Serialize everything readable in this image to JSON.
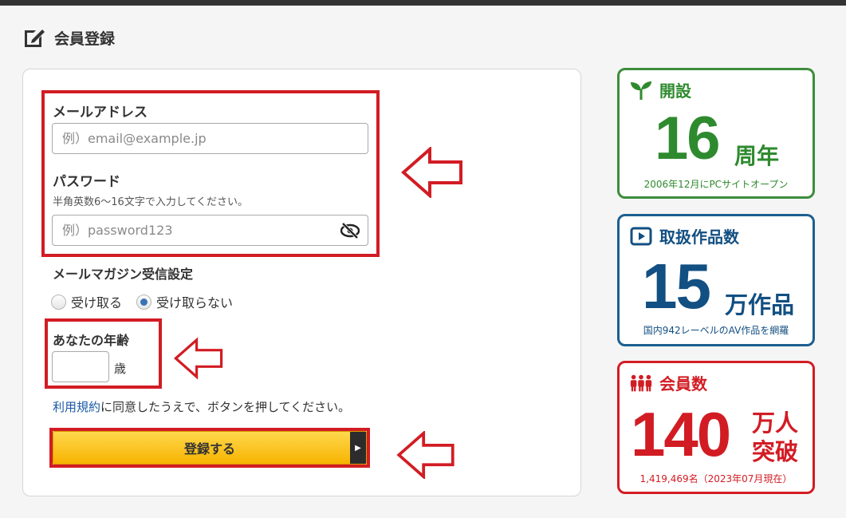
{
  "page": {
    "title": "会員登録",
    "title_icon": "edit-icon"
  },
  "form": {
    "email": {
      "label": "メールアドレス",
      "placeholder": "例）email@example.jp"
    },
    "password": {
      "label": "パスワード",
      "hint": "半角英数6〜16文字で入力してください。",
      "placeholder": "例）password123",
      "toggle_icon": "eye-slash-icon"
    },
    "newsletter": {
      "label": "メールマガジン受信設定",
      "options": [
        "受け取る",
        "受け取らない"
      ],
      "selected": "受け取らない"
    },
    "age": {
      "label": "あなたの年齢",
      "unit": "歳"
    },
    "terms": {
      "link": "利用規約",
      "text": "に同意したうえで、ボタンを押してください。"
    },
    "submit_label": "登録する"
  },
  "stats": [
    {
      "icon": "sprout-icon",
      "title": "開設",
      "number": "16",
      "suffix": "周年",
      "footnote": "2006年12月にPCサイトオープン",
      "color": "#2e8a2e"
    },
    {
      "icon": "play-icon",
      "title": "取扱作品数",
      "number": "15",
      "suffix": "万作品",
      "footnote": "国内942レーベルのAV作品を網羅",
      "color": "#124f82"
    },
    {
      "icon": "people-icon",
      "title": "会員数",
      "number": "140",
      "suffix_line1": "万人",
      "suffix_line2": "突破",
      "footnote": "1,419,469名（2023年07月現在）",
      "color": "#d21c24"
    }
  ],
  "colors": {
    "highlight": "#d21c24",
    "button": "#f7b300",
    "link": "#1a5aa6"
  }
}
